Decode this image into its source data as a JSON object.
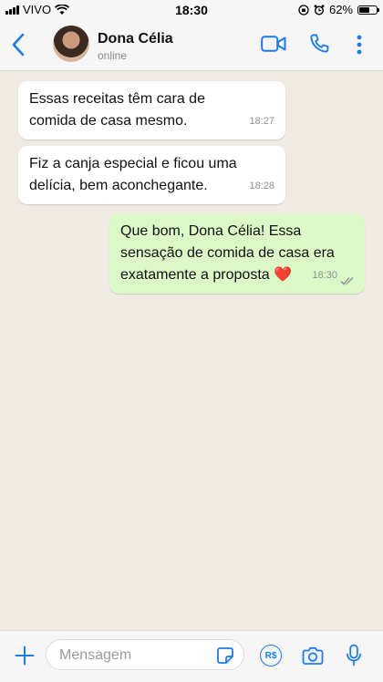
{
  "status_bar": {
    "carrier": "VIVO",
    "time": "18:30",
    "battery_percent": "62%",
    "battery_level": 0.62
  },
  "header": {
    "contact_name": "Dona Célia",
    "contact_status": "online",
    "accent_color": "#1a7cf5",
    "icons": [
      "back-icon",
      "video-call-icon",
      "phone-icon",
      "more-options-icon"
    ]
  },
  "messages": [
    {
      "direction": "in",
      "text": "Essas receitas têm cara de\ncomida de casa mesmo.",
      "time": "18:27"
    },
    {
      "direction": "in",
      "text": "Fiz a canja especial e ficou uma\ndelícia, bem aconchegante.",
      "time": "18:28"
    },
    {
      "direction": "out",
      "text": "Que bom, Dona Célia! Essa\nsensação de comida de casa era\nexatamente a proposta ❤️",
      "time": "18:30",
      "read_status": "delivered-ticks"
    }
  ],
  "input_bar": {
    "placeholder": "Mensagem",
    "pay_label": "R$",
    "icons": [
      "plus-icon",
      "sticker-icon",
      "payment-icon",
      "camera-icon",
      "microphone-icon"
    ]
  },
  "colors": {
    "chat_background": "#efeae2",
    "incoming_bubble": "#ffffff",
    "outgoing_bubble": "#dcf8c6"
  }
}
